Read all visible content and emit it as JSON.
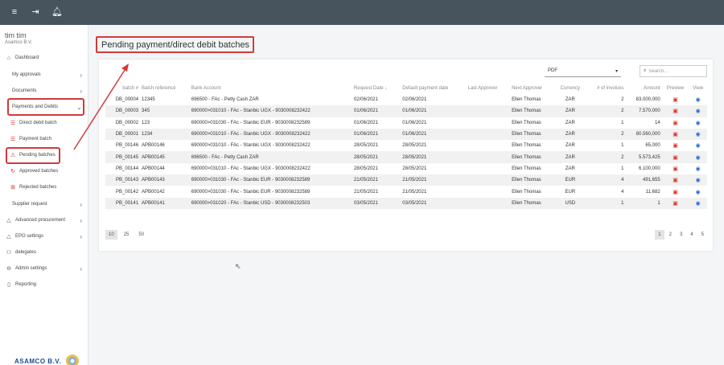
{
  "topbar": {
    "icons": [
      "menu-icon",
      "logout-icon",
      "bell-icon"
    ]
  },
  "user": {
    "name": "tim tim",
    "company": "Asamco B.V."
  },
  "sidebar": {
    "items": [
      {
        "label": "Dashboard",
        "icon": "home-icon"
      },
      {
        "label": "My approvals",
        "chevron": "›"
      },
      {
        "label": "Documents",
        "chevron": "›"
      },
      {
        "label": "Payments and Debits",
        "chevron": "⌄"
      },
      {
        "label": "Direct debit batch",
        "icon": "list-icon"
      },
      {
        "label": "Payment batch",
        "icon": "list-icon"
      },
      {
        "label": "Pending batches",
        "icon": "pending-icon"
      },
      {
        "label": "Approved batches",
        "icon": "approved-icon"
      },
      {
        "label": "Rejected batches",
        "icon": "rejected-icon"
      },
      {
        "label": "Supplier request",
        "chevron": "›"
      },
      {
        "label": "Advanced procurement",
        "icon": "cart-icon",
        "chevron": "›"
      },
      {
        "label": "EPO settings",
        "icon": "settings-icon",
        "chevron": "›"
      },
      {
        "label": "delegates",
        "icon": "users-icon"
      },
      {
        "label": "Admin settings",
        "icon": "lock-icon",
        "chevron": "›"
      },
      {
        "label": "Reporting",
        "icon": "document-icon"
      }
    ]
  },
  "logo": {
    "text": "ASAMCO B.V."
  },
  "page": {
    "title": "Pending payment/direct debit batches"
  },
  "toolbar": {
    "format_value": "PDF",
    "format_caret": "▾",
    "search_placeholder": "Search..."
  },
  "table": {
    "columns": [
      "batch #",
      "Batch reference",
      "Bank Account",
      "Request Date ↓",
      "Default payment date",
      "Last Approver",
      "Next Approver",
      "Currency",
      "# of invoices",
      "Amount",
      "Preview",
      "View"
    ],
    "rows": [
      [
        "DB_00004",
        "12345",
        "696500 - FAc - Petty Cash ZAR",
        "02/06/2021",
        "02/06/2021",
        "",
        "Ellen Thomas",
        "ZAR",
        "2",
        "83.000,000"
      ],
      [
        "DB_00003",
        "345",
        "690000>031010 - FAc - Stanbic UGX - 9030008232422",
        "01/06/2021",
        "01/06/2021",
        "",
        "Ellen Thomas",
        "ZAR",
        "2",
        "7.570,000"
      ],
      [
        "DB_00002",
        "123",
        "690000>031030 - FAc - Stanbic EUR - 9030008232589",
        "01/06/2021",
        "01/06/2021",
        "",
        "Ellen Thomas",
        "ZAR",
        "1",
        "14"
      ],
      [
        "DB_00001",
        "1234",
        "690000>031010 - FAc - Stanbic UGX - 9030008232422",
        "01/06/2021",
        "01/06/2021",
        "",
        "Ellen Thomas",
        "ZAR",
        "2",
        "80.560,000"
      ],
      [
        "PB_00146",
        "APB00146",
        "690000>031010 - FAc - Stanbic UGX - 9030008232422",
        "28/05/2021",
        "28/05/2021",
        "",
        "Ellen Thomas",
        "ZAR",
        "1",
        "65,000"
      ],
      [
        "PB_00145",
        "APB00145",
        "696500 - FAc - Petty Cash ZAR",
        "28/05/2021",
        "28/05/2021",
        "",
        "Ellen Thomas",
        "ZAR",
        "2",
        "5.573,425"
      ],
      [
        "PB_00144",
        "APB00144",
        "690000>031010 - FAc - Stanbic UGX - 9030008232422",
        "28/05/2021",
        "28/05/2021",
        "",
        "Ellen Thomas",
        "ZAR",
        "1",
        "6.100,000"
      ],
      [
        "PB_00143",
        "APB00143",
        "690000>031030 - FAc - Stanbic EUR - 9030008232589",
        "21/05/2021",
        "21/05/2021",
        "",
        "Ellen Thomas",
        "EUR",
        "4",
        "491,655"
      ],
      [
        "PB_00142",
        "APB00142",
        "690000>031030 - FAc - Stanbic EUR - 9030008232589",
        "21/05/2021",
        "21/05/2021",
        "",
        "Ellen Thomas",
        "EUR",
        "4",
        "11,682"
      ],
      [
        "PB_00141",
        "APB00141",
        "690000>031020 - FAc - Stanbic USD - 9030008232503",
        "03/05/2021",
        "03/05/2021",
        "",
        "Ellen Thomas",
        "USD",
        "1",
        "1"
      ]
    ]
  },
  "pagination": {
    "sizes": [
      "10",
      "25",
      "50"
    ],
    "pages": [
      "1",
      "2",
      "3",
      "4",
      "5"
    ]
  },
  "colors": {
    "topbar": "#47545e",
    "highlight": "#d23a3a",
    "eye": "#1e6bd6",
    "pdf": "#d9342b"
  }
}
